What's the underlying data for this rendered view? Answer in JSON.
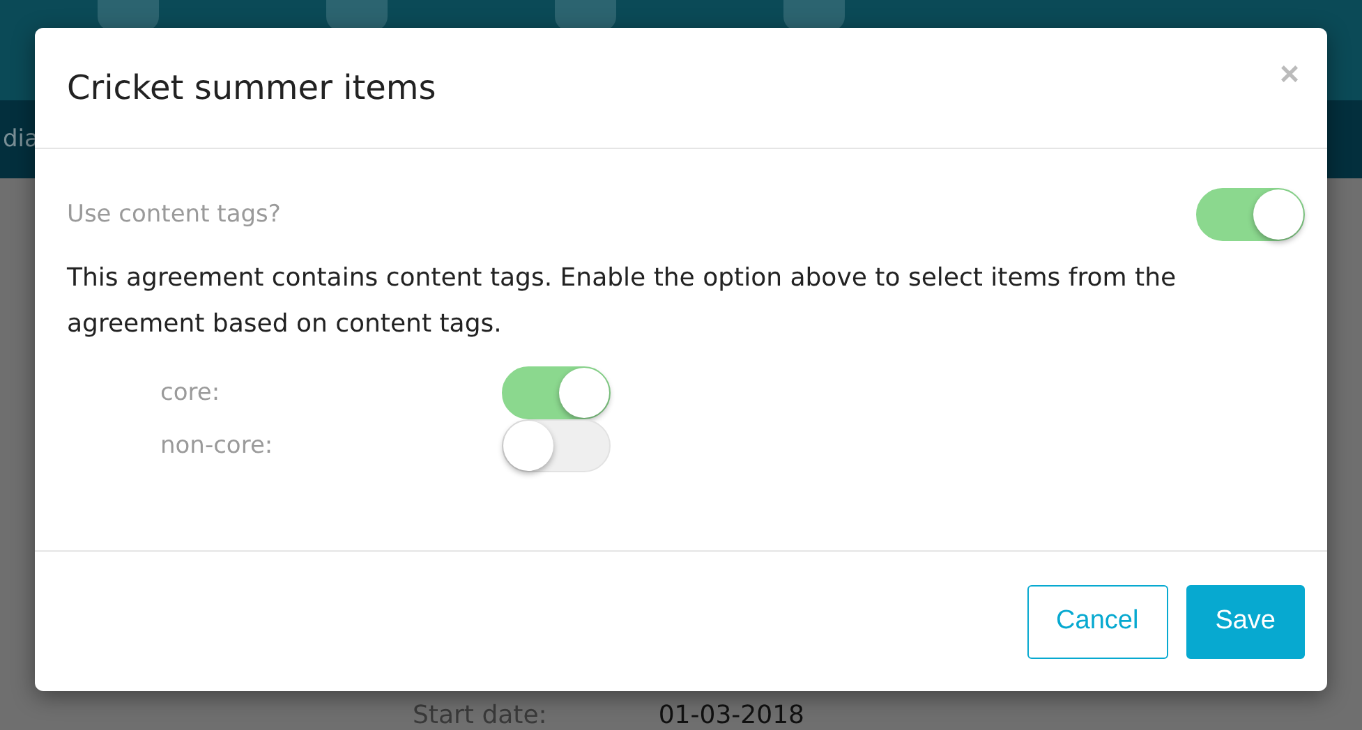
{
  "background": {
    "nav_label": "dia",
    "fields": [
      {
        "label": "Start date:",
        "value": "01-03-2018"
      }
    ]
  },
  "dialog": {
    "title": "Cricket summer items",
    "close": "×",
    "use_tags": {
      "label": "Use content tags?",
      "on": true
    },
    "description": "This agreement contains content tags. Enable the option above to select items from the agreement based on content tags.",
    "tags": [
      {
        "label": "core:",
        "on": true
      },
      {
        "label": "non-core:",
        "on": false
      }
    ],
    "buttons": [
      {
        "label": "Cancel",
        "kind": "secondary"
      },
      {
        "label": "Save",
        "kind": "primary"
      }
    ]
  }
}
